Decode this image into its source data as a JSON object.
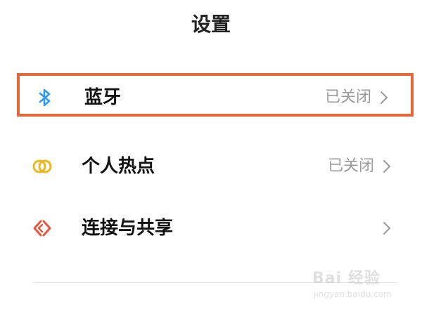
{
  "header": {
    "title": "设置"
  },
  "rows": [
    {
      "label": "蓝牙",
      "status": "已关闭",
      "icon": "bluetooth-icon"
    },
    {
      "label": "个人热点",
      "status": "已关闭",
      "icon": "hotspot-icon"
    },
    {
      "label": "连接与共享",
      "status": "",
      "icon": "share-icon"
    }
  ],
  "colors": {
    "highlight": "#e9663b",
    "bluetooth": "#2f9cf0",
    "hotspot": "#f2b51c",
    "share": "#e8573c"
  },
  "watermark": {
    "text": "Bai 经验",
    "sub": "jingyan.baidu.com"
  }
}
